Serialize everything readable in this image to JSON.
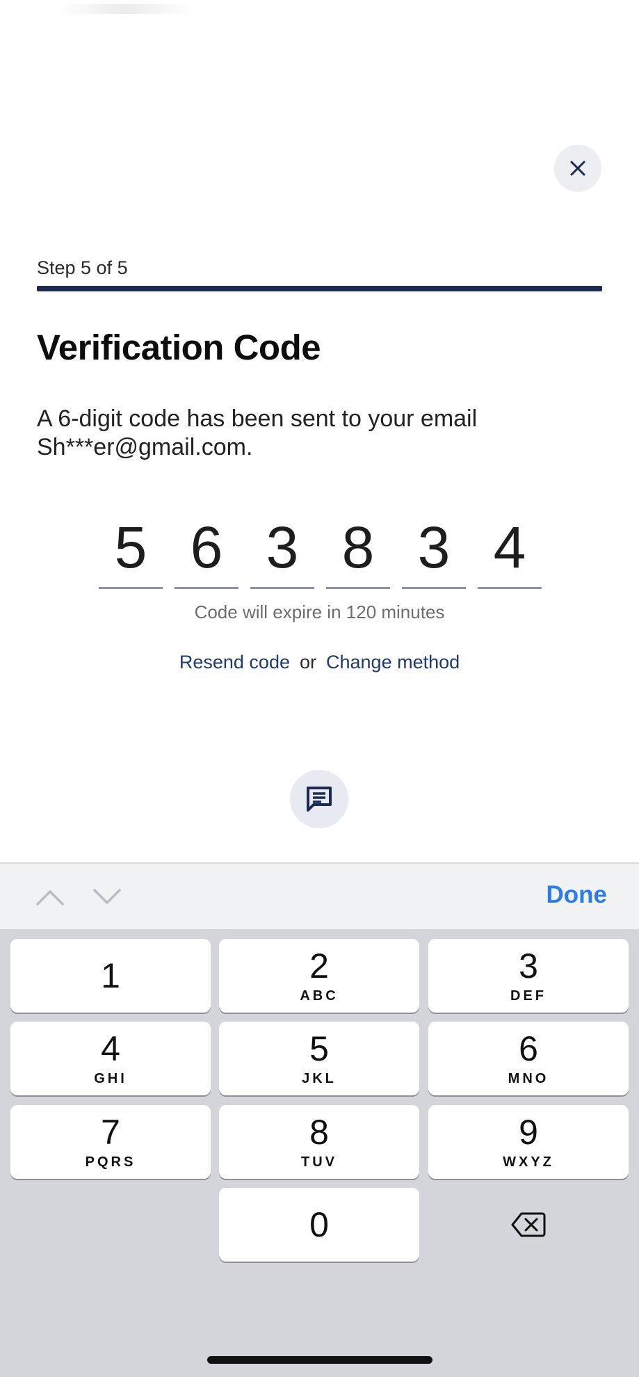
{
  "header": {
    "close_icon": "close-icon"
  },
  "progress": {
    "label": "Step 5 of 5",
    "fraction": 1.0,
    "color": "#1c2a55"
  },
  "title": "Verification Code",
  "description": "A 6-digit code has been sent to your email Sh***er@gmail.com.",
  "code": {
    "digits": [
      "5",
      "6",
      "3",
      "8",
      "3",
      "4"
    ]
  },
  "expire_text": "Code will expire in 120 minutes",
  "actions": {
    "resend": "Resend code",
    "or": "or",
    "change_method": "Change method"
  },
  "chat": {
    "icon": "chat-icon"
  },
  "keyboard_toolbar": {
    "prev_icon": "chevron-up-icon",
    "next_icon": "chevron-down-icon",
    "done": "Done"
  },
  "keypad": {
    "keys": [
      {
        "num": "1",
        "letters": ""
      },
      {
        "num": "2",
        "letters": "ABC"
      },
      {
        "num": "3",
        "letters": "DEF"
      },
      {
        "num": "4",
        "letters": "GHI"
      },
      {
        "num": "5",
        "letters": "JKL"
      },
      {
        "num": "6",
        "letters": "MNO"
      },
      {
        "num": "7",
        "letters": "PQRS"
      },
      {
        "num": "8",
        "letters": "TUV"
      },
      {
        "num": "9",
        "letters": "WXYZ"
      },
      {
        "num": "0",
        "letters": ""
      }
    ],
    "delete_icon": "backspace-icon"
  },
  "colors": {
    "accent": "#1c2a55",
    "link": "#1f3a6e",
    "done": "#2f7de1"
  }
}
